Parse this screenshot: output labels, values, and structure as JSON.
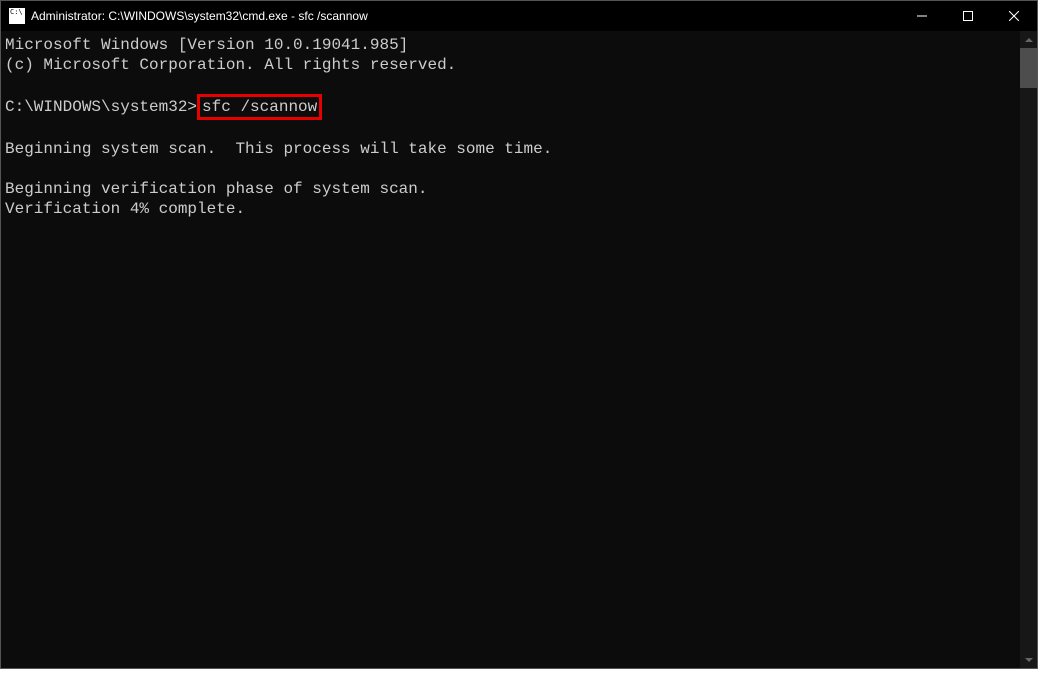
{
  "window": {
    "title": "Administrator: C:\\WINDOWS\\system32\\cmd.exe - sfc  /scannow"
  },
  "terminal": {
    "line1": "Microsoft Windows [Version 10.0.19041.985]",
    "line2": "(c) Microsoft Corporation. All rights reserved.",
    "blank1": "",
    "prompt": "C:\\WINDOWS\\system32>",
    "command": "sfc /scannow",
    "blank2": "",
    "scanMsg": "Beginning system scan.  This process will take some time.",
    "blank3": "",
    "verifyMsg": "Beginning verification phase of system scan.",
    "progressMsg": "Verification 4% complete."
  }
}
